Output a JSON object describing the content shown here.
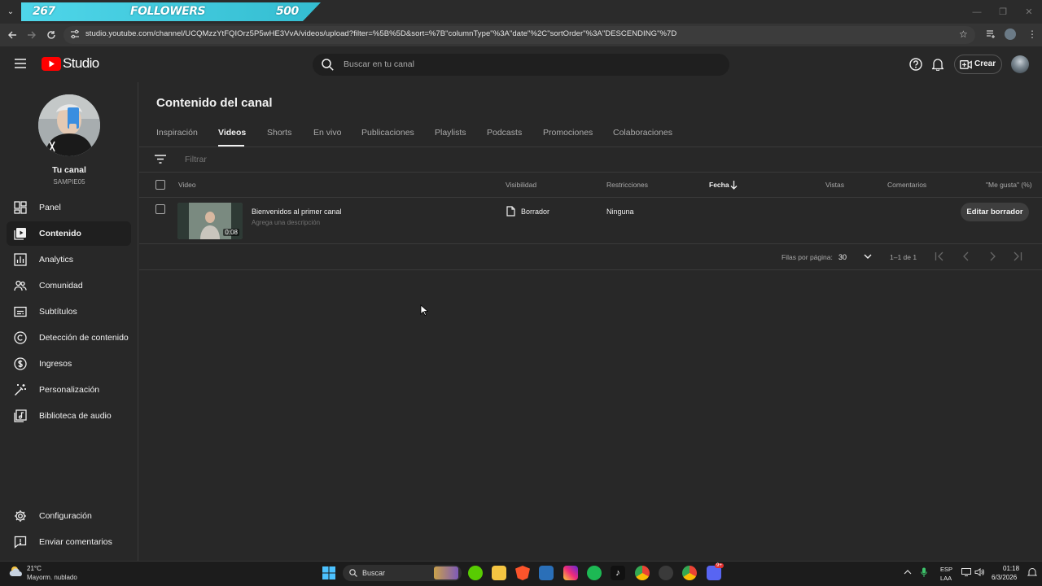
{
  "browser": {
    "tab": {
      "left_text": "267",
      "middle_text": "FOLLOWERS",
      "right_text": "500"
    },
    "url": "studio.youtube.com/channel/UCQMzzYtFQIOrz5P5wHE3VvA/videos/upload?filter=%5B%5D&sort=%7B\"columnType\"%3A\"date\"%2C\"sortOrder\"%3A\"DESCENDING\"%7D"
  },
  "header": {
    "logo_text": "Studio",
    "search_placeholder": "Buscar en tu canal",
    "create_label": "Crear",
    "icons": [
      "menu-icon",
      "help-icon",
      "bell-icon",
      "create-video-icon"
    ]
  },
  "channel": {
    "label": "Tu canal",
    "name": "SAMPIE05"
  },
  "sidebar": {
    "items": [
      {
        "label": "Panel",
        "icon": "dashboard-icon"
      },
      {
        "label": "Contenido",
        "icon": "content-icon",
        "active": true
      },
      {
        "label": "Analytics",
        "icon": "analytics-icon"
      },
      {
        "label": "Comunidad",
        "icon": "community-icon"
      },
      {
        "label": "Subtítulos",
        "icon": "subtitles-icon"
      },
      {
        "label": "Detección de contenido",
        "icon": "copyright-icon"
      },
      {
        "label": "Ingresos",
        "icon": "dollar-icon"
      },
      {
        "label": "Personalización",
        "icon": "magic-wand-icon"
      },
      {
        "label": "Biblioteca de audio",
        "icon": "audio-library-icon"
      }
    ],
    "bottom": [
      {
        "label": "Configuración",
        "icon": "gear-icon"
      },
      {
        "label": "Enviar comentarios",
        "icon": "feedback-icon"
      }
    ]
  },
  "main": {
    "title": "Contenido del canal",
    "tabs": [
      "Inspiración",
      "Videos",
      "Shorts",
      "En vivo",
      "Publicaciones",
      "Playlists",
      "Podcasts",
      "Promociones",
      "Colaboraciones"
    ],
    "active_tab": "Videos",
    "filter_placeholder": "Filtrar",
    "columns": {
      "video": "Video",
      "visibility": "Visibilidad",
      "restrictions": "Restricciones",
      "date": "Fecha",
      "views": "Vistas",
      "comments": "Comentarios",
      "likes": "\"Me gusta\" (%)"
    },
    "rows": [
      {
        "title": "Bienvenidos al primer canal",
        "description": "Agrega una descripción",
        "duration": "0:08",
        "visibility": "Borrador",
        "restrictions": "Ninguna",
        "action": "Editar borrador"
      }
    ],
    "pagination": {
      "rows_per_page_label": "Filas por página:",
      "rows_per_page": "30",
      "range": "1–1 de 1"
    }
  },
  "taskbar": {
    "weather_temp": "21°C",
    "weather_desc": "Mayorm. nublado",
    "search_label": "Buscar",
    "lang_top": "ESP",
    "lang_bottom": "LAA",
    "time": "01:18",
    "date": "6/3/2026",
    "discord_badge": "9+"
  },
  "colors": {
    "background": "#282828",
    "youtube_red": "#ff0000",
    "tab_cyan": "#4fd6e9"
  }
}
